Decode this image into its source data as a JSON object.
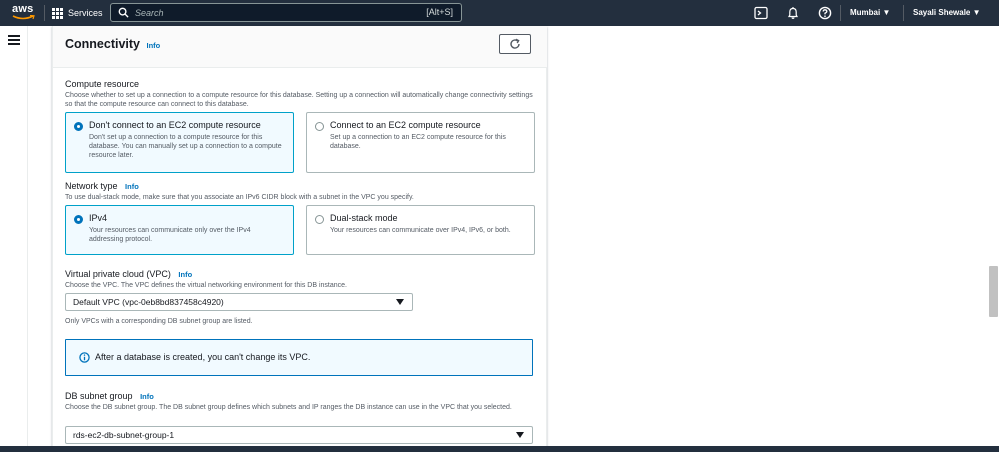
{
  "topnav": {
    "logo_text": "aws",
    "services_label": "Services",
    "search_placeholder": "Search",
    "search_shortcut": "[Alt+S]",
    "region": "Mumbai ▼",
    "user": "Sayali Shewale ▼",
    "icons": [
      "cloudshell-icon",
      "bell-icon",
      "help-icon"
    ]
  },
  "panel": {
    "title": "Connectivity",
    "info": "Info",
    "compute": {
      "label": "Compute resource",
      "description": "Choose whether to set up a connection to a compute resource for this database. Setting up a connection will automatically change connectivity settings so that the compute resource can connect to this database.",
      "options": [
        {
          "title": "Don't connect to an EC2 compute resource",
          "description": "Don't set up a connection to a compute resource for this database. You can manually set up a connection to a compute resource later.",
          "selected": true
        },
        {
          "title": "Connect to an EC2 compute resource",
          "description": "Set up a connection to an EC2 compute resource for this database.",
          "selected": false
        }
      ]
    },
    "network": {
      "label": "Network type",
      "info": "Info",
      "description": "To use dual-stack mode, make sure that you associate an IPv6 CIDR block with a subnet in the VPC you specify.",
      "options": [
        {
          "title": "IPv4",
          "description": "Your resources can communicate only over the IPv4 addressing protocol.",
          "selected": true
        },
        {
          "title": "Dual-stack mode",
          "description": "Your resources can communicate over IPv4, IPv6, or both.",
          "selected": false
        }
      ]
    },
    "vpc": {
      "label": "Virtual private cloud (VPC)",
      "info": "Info",
      "description": "Choose the VPC. The VPC defines the virtual networking environment for this DB instance.",
      "value": "Default VPC (vpc-0eb8bd837458c4920)",
      "hint": "Only VPCs with a corresponding DB subnet group are listed."
    },
    "alert": {
      "text": "After a database is created, you can't change its VPC."
    },
    "subnet": {
      "label": "DB subnet group",
      "info": "Info",
      "description": "Choose the DB subnet group. The DB subnet group defines which subnets and IP ranges the DB instance can use in the VPC that you selected.",
      "value": "rds-ec2-db-subnet-group-1"
    }
  },
  "colors": {
    "nav_bg": "#232f3e",
    "link": "#0073bb",
    "selected_border": "#00a1c9",
    "selected_bg": "#f1faff"
  }
}
